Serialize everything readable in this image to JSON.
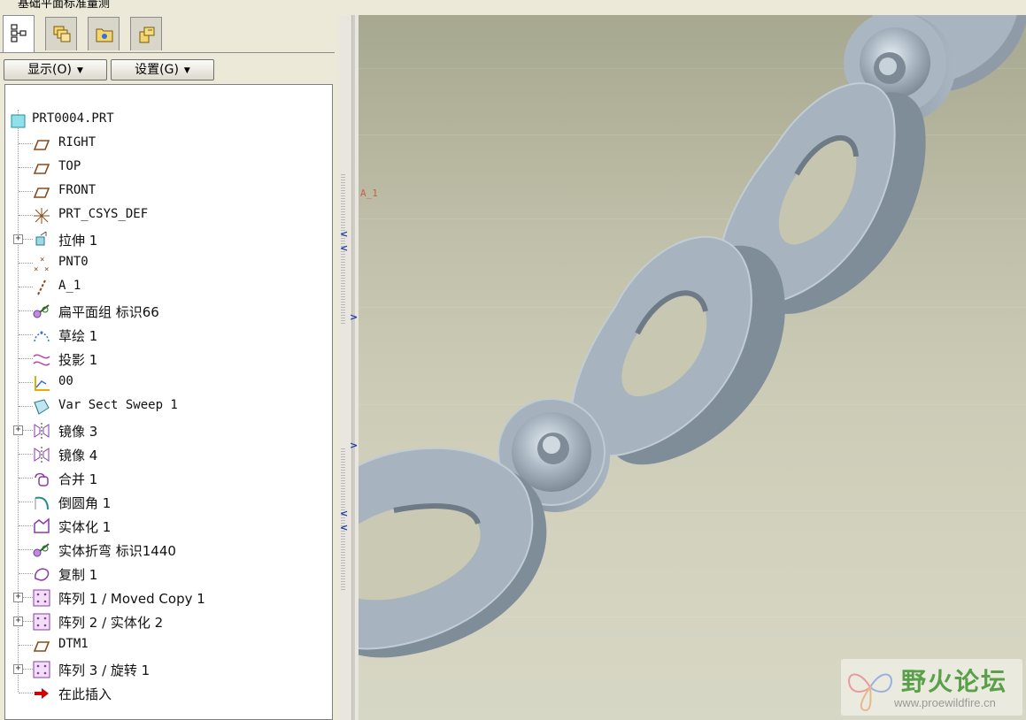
{
  "window": {
    "title_fragment": "基础平面标准量测"
  },
  "panel": {
    "tabs": [
      {
        "name": "model-tree-tab",
        "icon": "model-tree-icon",
        "active": true
      },
      {
        "name": "layers-tab",
        "icon": "layers-icon",
        "active": false
      },
      {
        "name": "folder-browser-tab",
        "icon": "folder-icon",
        "active": false
      },
      {
        "name": "favorites-tab",
        "icon": "favorites-icon",
        "active": false
      }
    ],
    "show_label": "显示(O)",
    "settings_label": "设置(G)"
  },
  "tree": {
    "root": "PRT0004.PRT",
    "items": [
      {
        "label": "RIGHT",
        "icon": "datum-plane-icon",
        "expandable": false
      },
      {
        "label": "TOP",
        "icon": "datum-plane-icon",
        "expandable": false
      },
      {
        "label": "FRONT",
        "icon": "datum-plane-icon",
        "expandable": false
      },
      {
        "label": "PRT_CSYS_DEF",
        "icon": "csys-icon",
        "expandable": false
      },
      {
        "label": "拉伸 1",
        "icon": "extrude-icon",
        "expandable": true
      },
      {
        "label": "PNT0",
        "icon": "datum-point-icon",
        "expandable": false
      },
      {
        "label": "A_1",
        "icon": "datum-axis-icon",
        "expandable": false
      },
      {
        "label": "扁平面组 标识66",
        "icon": "flatten-quilt-icon",
        "expandable": false
      },
      {
        "label": "草绘 1",
        "icon": "sketch-icon",
        "expandable": false
      },
      {
        "label": "投影 1",
        "icon": "projection-icon",
        "expandable": false
      },
      {
        "label": "00",
        "icon": "graph-icon",
        "expandable": false
      },
      {
        "label": "Var Sect Sweep 1",
        "icon": "sweep-icon",
        "expandable": false
      },
      {
        "label": "镜像 3",
        "icon": "mirror-icon",
        "expandable": true
      },
      {
        "label": "镜像 4",
        "icon": "mirror-icon",
        "expandable": false
      },
      {
        "label": "合并 1",
        "icon": "merge-icon",
        "expandable": false
      },
      {
        "label": "倒圆角 1",
        "icon": "round-icon",
        "expandable": false
      },
      {
        "label": "实体化 1",
        "icon": "solidify-icon",
        "expandable": false
      },
      {
        "label": "实体折弯 标识1440",
        "icon": "toroidal-bend-icon",
        "expandable": false
      },
      {
        "label": "复制 1",
        "icon": "copy-icon",
        "expandable": false
      },
      {
        "label": "阵列 1 / Moved Copy 1",
        "icon": "pattern-icon",
        "expandable": true
      },
      {
        "label": "阵列 2 / 实体化 2",
        "icon": "pattern-icon",
        "expandable": true
      },
      {
        "label": "DTM1",
        "icon": "datum-plane-icon",
        "expandable": false
      },
      {
        "label": "阵列 3 / 旋转 1",
        "icon": "pattern-icon",
        "expandable": true
      },
      {
        "label": "在此插入",
        "icon": "insert-here-arrow-icon",
        "expandable": false
      }
    ]
  },
  "viewport": {
    "annotation": "A_1",
    "watermark_cn": "野火论坛",
    "watermark_url": "www.proewildfire.cn"
  },
  "colors": {
    "model": "#9aa8b4",
    "background_top": "#a7a890",
    "background_bottom": "#d7d7c5",
    "datum_plane": "#8a4a1a",
    "insert_arrow": "#d40000",
    "pattern": "#8a3aa8"
  }
}
